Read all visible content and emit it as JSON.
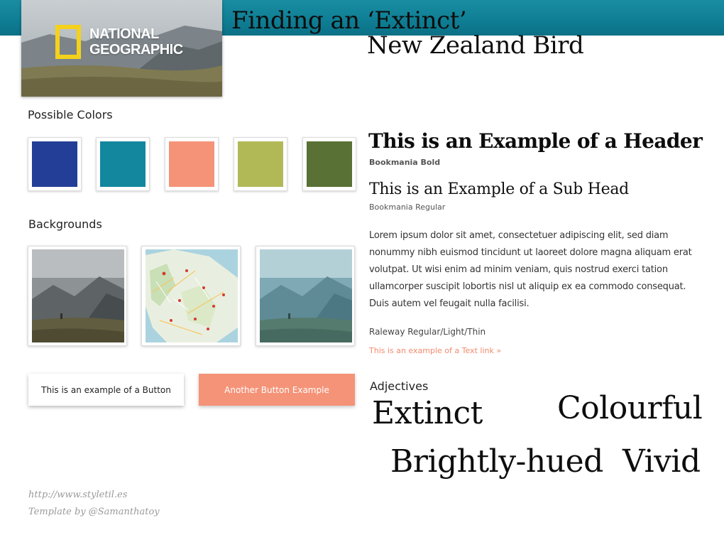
{
  "brand": {
    "logo_line1": "NATIONAL",
    "logo_line2": "GEOGRAPHIC",
    "mark_color": "#f5d11b",
    "band_color": "#0f7f95"
  },
  "title": {
    "line1": "Finding an ‘Extinct’",
    "line2": "New Zealand Bird"
  },
  "colors": {
    "label": "Possible Colors",
    "swatches": [
      "#233e96",
      "#12879e",
      "#f59378",
      "#b1b957",
      "#597134"
    ]
  },
  "backgrounds": {
    "label": "Backgrounds",
    "items": [
      {
        "name": "misty-mountain-photo"
      },
      {
        "name": "new-zealand-map"
      },
      {
        "name": "teal-tinted-mountain-photo"
      }
    ]
  },
  "buttons": {
    "primary_label": "This is an example of a Button",
    "secondary_label": "Another Button Example"
  },
  "footer": {
    "url": "http://www.styletil.es",
    "credit": "Template by @Samanthatoy"
  },
  "typography": {
    "header": "This is an Example of a Header",
    "header_font": "Bookmania Bold",
    "subhead": "This is an Example of a Sub Head",
    "subhead_font": "Bookmania Regular",
    "body": "Lorem ipsum dolor sit amet, consectetuer adipiscing elit, sed diam nonummy nibh euismod tincidunt ut laoreet dolore magna aliquam erat volutpat. Ut wisi enim ad minim veniam, quis nostrud exerci tation ullamcorper suscipit lobortis nisl ut aliquip ex ea commodo consequat. Duis autem vel feugait nulla facilisi.",
    "body_font": "Raleway Regular/Light/Thin",
    "link": "This is an example of a Text link »",
    "link_color": "#f28a6d"
  },
  "adjectives": {
    "label": "Adjectives",
    "words": [
      "Extinct",
      "Colourful",
      "Brightly-hued",
      "Vivid"
    ]
  }
}
